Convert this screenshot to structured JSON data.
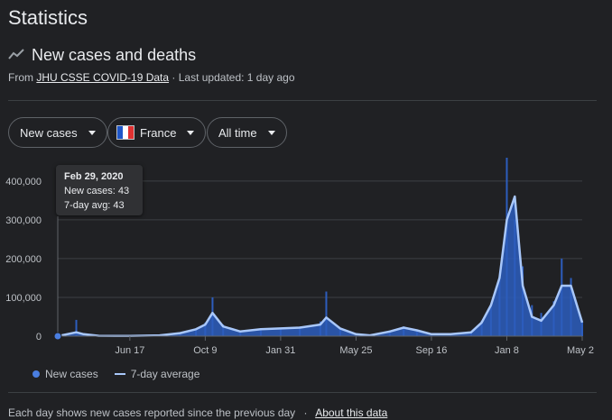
{
  "page": {
    "title": "Statistics"
  },
  "section": {
    "title": "New cases and deaths",
    "icon": "trending-line-icon",
    "source_prefix": "From",
    "source_link": "JHU CSSE COVID-19 Data",
    "updated": "· Last updated: 1 day ago"
  },
  "filters": {
    "metric": "New cases",
    "location": "France",
    "range": "All time"
  },
  "tooltip": {
    "date": "Feb 29, 2020",
    "new_cases": "New cases: 43",
    "avg": "7-day avg: 43"
  },
  "legend": {
    "bars": "New cases",
    "line": "7-day average"
  },
  "footer": {
    "note": "Each day shows new cases reported since the previous day",
    "separator": "·",
    "link": "About this data"
  },
  "colors": {
    "bar": "#2d5dbd",
    "avg_line": "#a8c7fa",
    "grid": "#3c4043",
    "flag_blue": "#1e56c8",
    "flag_white": "#ffffff",
    "flag_red": "#e03131"
  },
  "chart_data": {
    "type": "bar",
    "xlabel": "",
    "ylabel": "",
    "ylim": [
      0,
      400000
    ],
    "yticks": [
      "0",
      "100,000",
      "200,000",
      "300,000",
      "400,000"
    ],
    "xticks": [
      "Jun 17",
      "Oct 9",
      "Jan 31",
      "May 25",
      "Sep 16",
      "Jan 8",
      "May 2"
    ],
    "series": [
      {
        "name": "New cases",
        "kind": "bars"
      },
      {
        "name": "7-day average",
        "kind": "line"
      }
    ],
    "x": [
      "2020-02-29",
      "2020-03-28",
      "2020-04-08",
      "2020-05-01",
      "2020-06-17",
      "2020-08-01",
      "2020-09-01",
      "2020-09-25",
      "2020-10-09",
      "2020-10-20",
      "2020-11-05",
      "2020-12-01",
      "2021-01-01",
      "2021-01-31",
      "2021-03-01",
      "2021-04-01",
      "2021-04-10",
      "2021-05-01",
      "2021-05-25",
      "2021-06-15",
      "2021-07-15",
      "2021-08-05",
      "2021-08-25",
      "2021-09-16",
      "2021-10-15",
      "2021-11-15",
      "2021-12-01",
      "2021-12-15",
      "2021-12-28",
      "2022-01-08",
      "2022-01-20",
      "2022-02-01",
      "2022-02-15",
      "2022-03-01",
      "2022-03-20",
      "2022-04-01",
      "2022-04-15",
      "2022-05-02"
    ],
    "values": [
      43,
      42000,
      8000,
      1000,
      500,
      2000,
      8000,
      20000,
      35000,
      100000,
      30000,
      15000,
      20000,
      22000,
      25000,
      38000,
      115000,
      20000,
      5000,
      2000,
      15000,
      25000,
      15000,
      5000,
      5000,
      10000,
      40000,
      80000,
      150000,
      460000,
      300000,
      180000,
      80000,
      60000,
      90000,
      200000,
      150000,
      40000
    ],
    "avg": [
      43,
      10000,
      5000,
      1000,
      500,
      2000,
      8000,
      18000,
      30000,
      60000,
      25000,
      12000,
      18000,
      20000,
      22000,
      30000,
      48000,
      20000,
      5000,
      2000,
      12000,
      22000,
      15000,
      5000,
      5000,
      10000,
      35000,
      80000,
      150000,
      300000,
      360000,
      130000,
      50000,
      40000,
      80000,
      130000,
      130000,
      35000
    ]
  }
}
